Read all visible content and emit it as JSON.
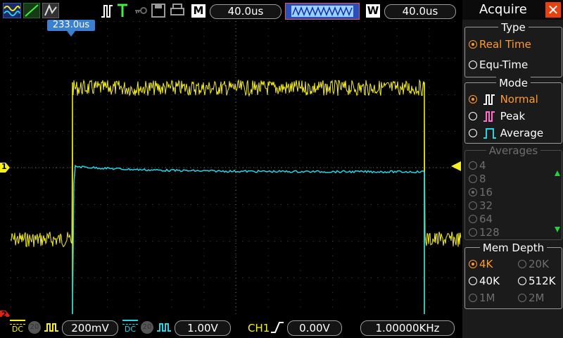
{
  "topbar": {
    "timebase_label": "M",
    "timebase_value": "40.0us",
    "window_label": "W",
    "window_value": "40.0us"
  },
  "trigger_marker": "233.0us",
  "channel_marker_1": "1",
  "channel_marker_2": "2",
  "panel": {
    "title": "Acquire",
    "type_head": "Type",
    "type_options": [
      "Real Time",
      "Equ-Time"
    ],
    "mode_head": "Mode",
    "mode_options": [
      "Normal",
      "Peak",
      "Average"
    ],
    "averages_head": "Averages",
    "averages_options": [
      "4",
      "8",
      "16",
      "32",
      "64",
      "128"
    ],
    "memdepth_head": "Mem Depth",
    "memdepth_options": [
      "4K",
      "20K",
      "40K",
      "512K",
      "1M",
      "2M"
    ]
  },
  "bottombar": {
    "ch1_coupling": "DC",
    "ch1_bw": "20",
    "ch1_scale": "200mV",
    "ch2_coupling": "DC",
    "ch2_bw": "20",
    "ch2_scale": "1.00V",
    "trig_source": "CH1",
    "trig_level": "0.00V",
    "frequency": "1.00000KHz"
  },
  "colors": {
    "ch1": "#f5ef1d",
    "ch2": "#27d3e6",
    "accent": "#ff9a2e",
    "close": "#e8410f"
  }
}
